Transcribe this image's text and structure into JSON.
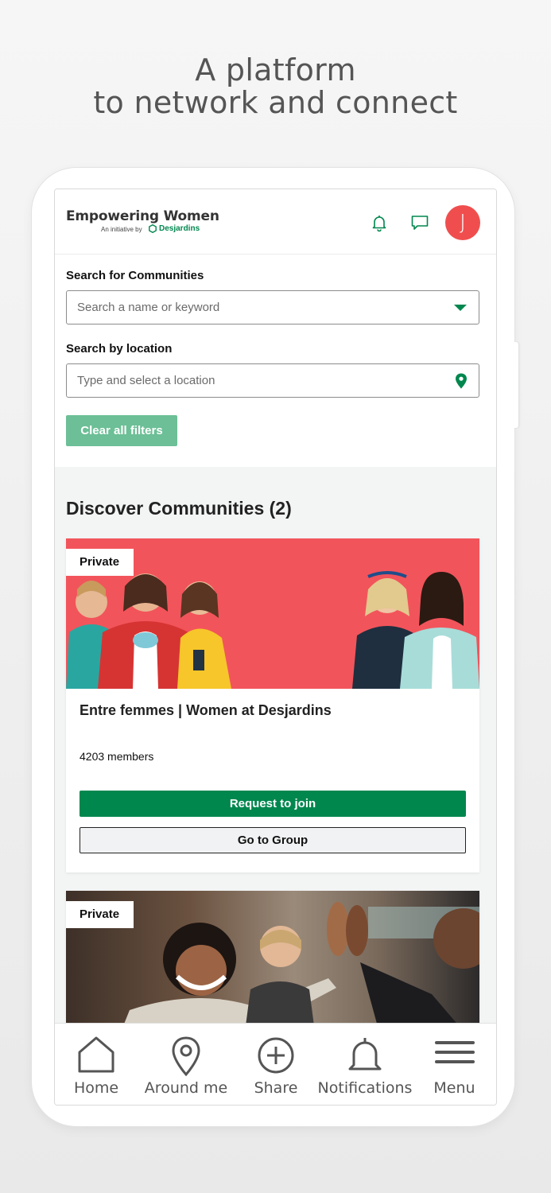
{
  "headline": {
    "line1": "A platform",
    "line2": "to network and connect"
  },
  "header": {
    "title": "Empowering Women",
    "subtitle": "An initiative by",
    "brand": "Desjardins",
    "avatar_initial": "J",
    "accent_color": "#00874e",
    "avatar_color": "#f04e4e"
  },
  "filters": {
    "communities_label": "Search for Communities",
    "communities_placeholder": "Search a name or keyword",
    "location_label": "Search by location",
    "location_placeholder": "Type and select a location",
    "clear_label": "Clear all filters"
  },
  "discover": {
    "title": "Discover Communities (2)",
    "cards": [
      {
        "tag": "Private",
        "title": "Entre femmes | Women at Desjardins",
        "members": "4203 members",
        "join_label": "Request to join",
        "goto_label": "Go to Group"
      },
      {
        "tag": "Private"
      }
    ]
  },
  "tabbar": {
    "items": [
      {
        "label": "Home",
        "icon": "home-icon"
      },
      {
        "label": "Around me",
        "icon": "map-pin-icon"
      },
      {
        "label": "Share",
        "icon": "plus-circle-icon"
      },
      {
        "label": "Notifications",
        "icon": "bell-icon"
      },
      {
        "label": "Menu",
        "icon": "hamburger-icon"
      }
    ]
  }
}
